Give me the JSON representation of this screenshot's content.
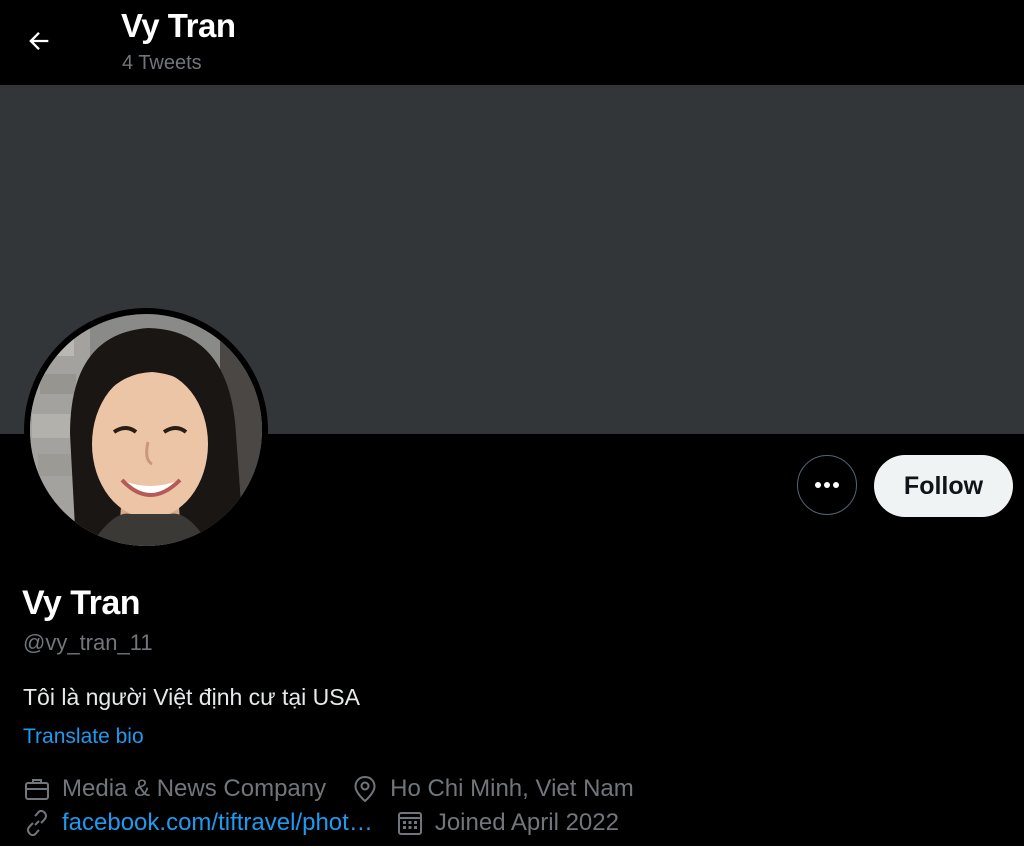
{
  "header": {
    "back_icon": "arrow-left-icon",
    "name": "Vy Tran",
    "tweet_count": "4 Tweets"
  },
  "colors": {
    "background": "#000000",
    "banner": "#333639",
    "accent": "#1d9bf0",
    "muted": "#71767b",
    "follow_bg": "#eff3f4"
  },
  "actions": {
    "more_icon": "more-horizontal-icon",
    "follow_label": "Follow"
  },
  "profile": {
    "display_name": "Vy Tran",
    "handle": "@vy_tran_11",
    "bio": "Tôi là người Việt định cư tại USA",
    "translate_label": "Translate bio",
    "category": "Media & News Company",
    "location": "Ho Chi Minh, Viet Nam",
    "website": "facebook.com/tiftravel/phot…",
    "joined": "Joined April 2022",
    "icons": {
      "category": "briefcase-icon",
      "location": "location-pin-icon",
      "website": "link-icon",
      "joined": "calendar-icon"
    }
  }
}
